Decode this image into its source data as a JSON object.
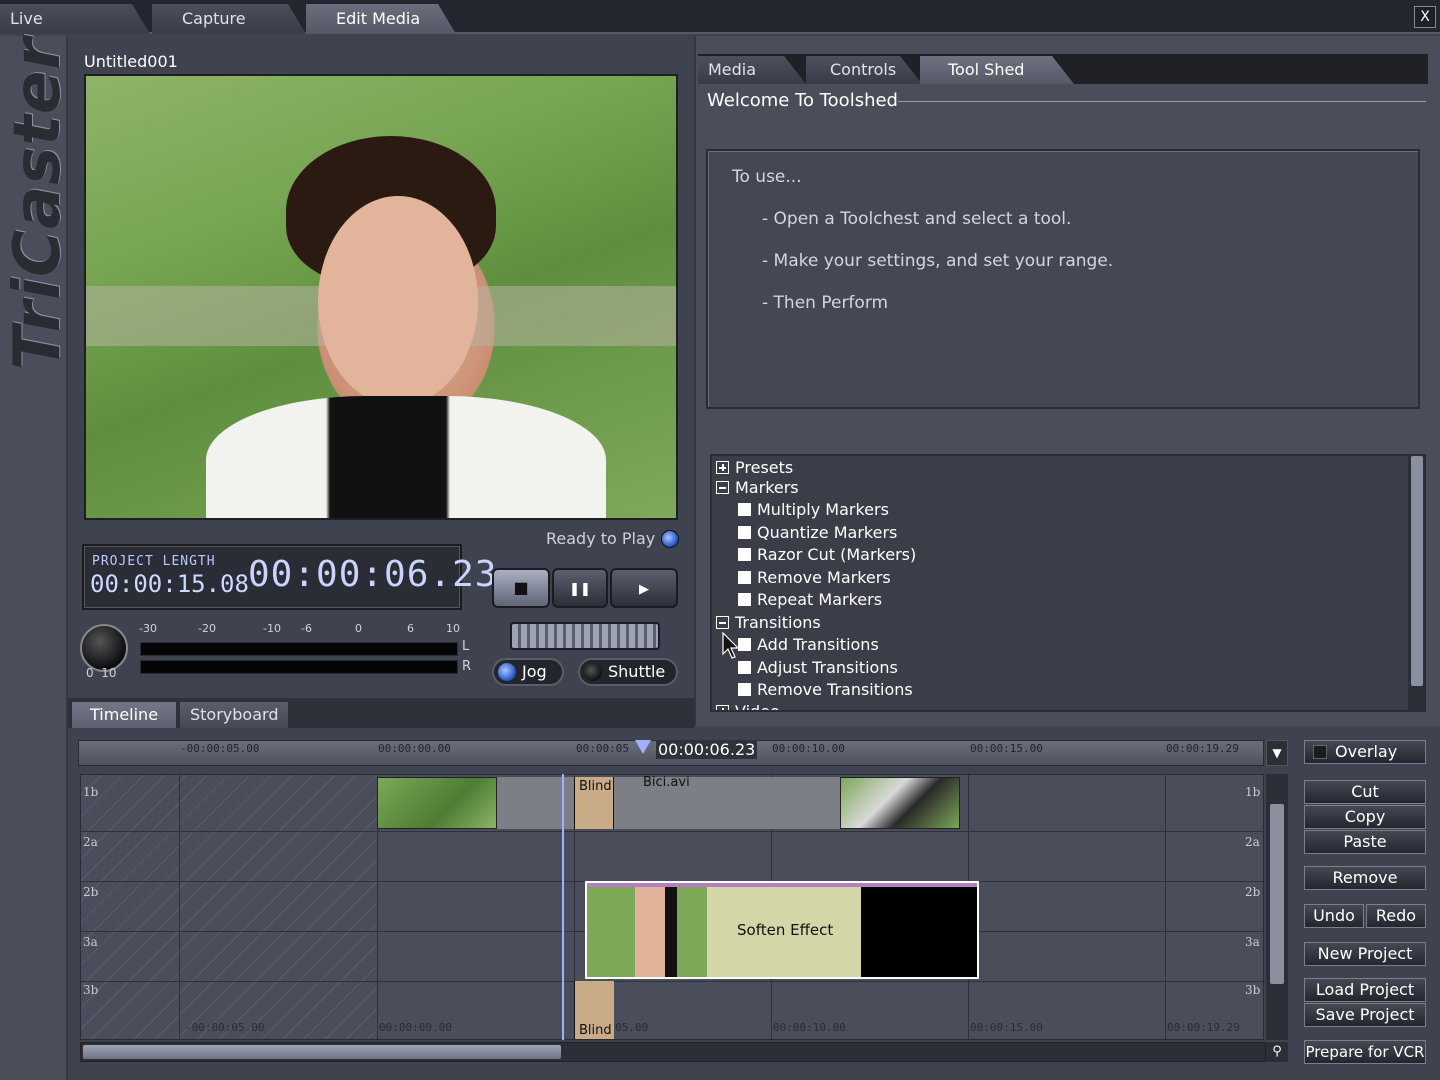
{
  "top_tabs": [
    {
      "label": "Live Production",
      "active": false
    },
    {
      "label": "Capture Media",
      "active": false
    },
    {
      "label": "Edit Media",
      "active": true
    }
  ],
  "close_label": "X",
  "brand": "TriCaster",
  "project_name": "Untitled001",
  "status": {
    "ready_text": "Ready to Play"
  },
  "timecode": {
    "project_length_label": "PROJECT LENGTH",
    "project_length": "00:00:15.08",
    "current": "00:00:06.23"
  },
  "transport": {
    "stop": "■",
    "pause": "❚❚",
    "play": "▶"
  },
  "audio": {
    "knob_label": "0  10",
    "scale": [
      "-30",
      "-20",
      "-10",
      "-6",
      "0",
      "6",
      "10"
    ],
    "left": "L",
    "right": "R"
  },
  "jog_label": "Jog",
  "shuttle_label": "Shuttle",
  "right_tabs": [
    {
      "label": "Media Bin",
      "active": false
    },
    {
      "label": "Controls",
      "active": false
    },
    {
      "label": "Tool Shed",
      "active": true
    }
  ],
  "toolshed": {
    "title": "Welcome To Toolshed",
    "lines": [
      "To use...",
      "- Open a Toolchest and select a tool.",
      "- Make your settings, and set your range.",
      "- Then Perform"
    ]
  },
  "tree": {
    "presets": "Presets",
    "markers": "Markers",
    "marker_items": [
      "Multiply Markers",
      "Quantize Markers",
      "Razor Cut (Markers)",
      "Remove Markers",
      "Repeat Markers"
    ],
    "transitions": "Transitions",
    "transition_items": [
      "Add Transitions",
      "Adjust Transitions",
      "Remove Transitions"
    ],
    "video_partial": "Video"
  },
  "bottom_tabs": [
    {
      "label": "Timeline",
      "active": true
    },
    {
      "label": "Storyboard",
      "active": false
    }
  ],
  "ruler": {
    "labels": [
      "-00:00:05.00",
      "00:00:00.00",
      "00:00:05",
      "00:00:10.00",
      "00:00:15.00",
      "00:00:19.29"
    ],
    "playhead_tc": "00:00:06.23"
  },
  "tracks": {
    "labels": [
      "1b",
      "2a",
      "2b",
      "3a",
      "3b"
    ],
    "blind_label": "Blind",
    "bici_label": "Bici.avi",
    "soften_label": "Soften Effect",
    "bottom_ticks": [
      "-00:00:05.00",
      "00:00:00.00",
      "05.00",
      "00:00:10.00",
      "00:00:15.00",
      "00:00:19.29"
    ]
  },
  "buttons": {
    "overlay": "Overlay",
    "cut": "Cut",
    "copy": "Copy",
    "paste": "Paste",
    "remove": "Remove",
    "undo": "Undo",
    "redo": "Redo",
    "new_project": "New Project",
    "load_project": "Load Project",
    "save_project": "Save Project",
    "prepare_vcr": "Prepare for VCR"
  }
}
